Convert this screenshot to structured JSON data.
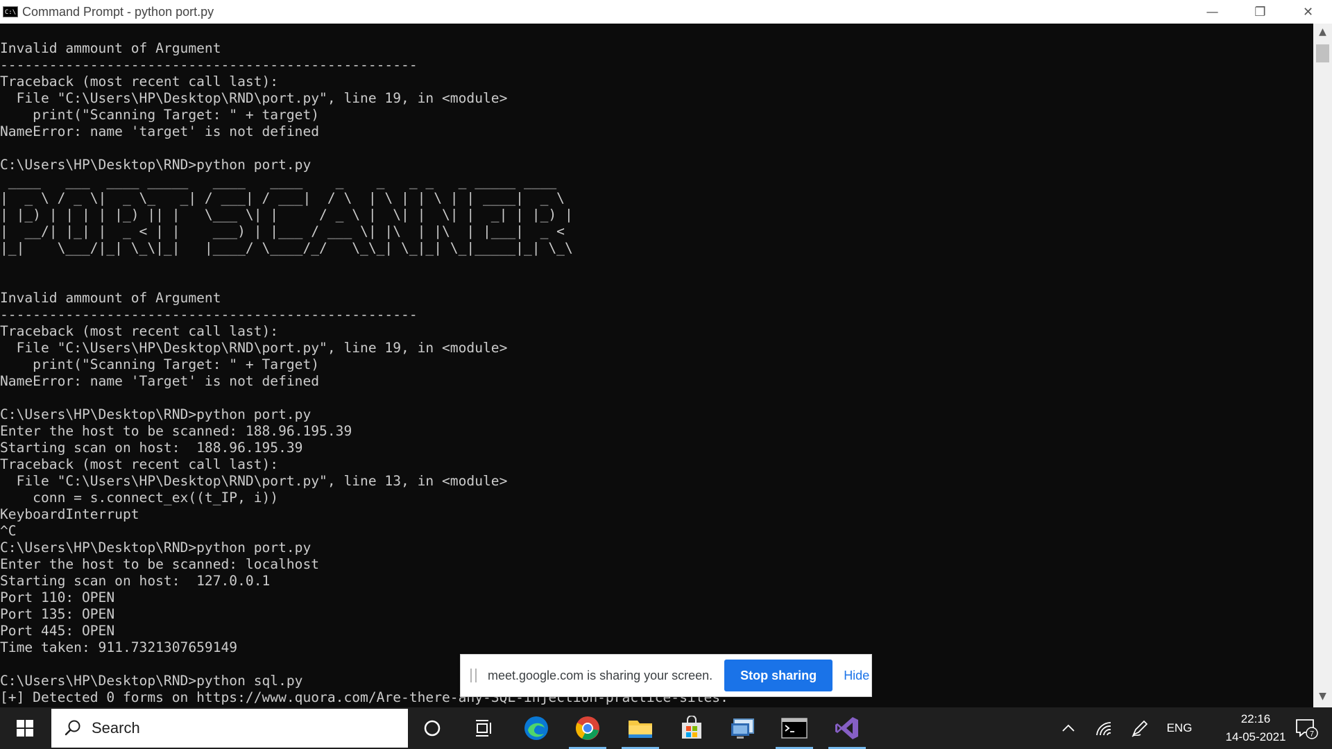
{
  "window": {
    "title": "Command Prompt - python  port.py",
    "icon_label": "C:\\",
    "controls": {
      "minimize": "—",
      "restore": "❐",
      "close": "✕"
    }
  },
  "console": {
    "lines": [
      "Invalid ammount of Argument",
      "---------------------------------------------------",
      "Traceback (most recent call last):",
      "  File \"C:\\Users\\HP\\Desktop\\RND\\port.py\", line 19, in <module>",
      "    print(\"Scanning Target: \" + target)",
      "NameError: name 'target' is not defined",
      "",
      "C:\\Users\\HP\\Desktop\\RND>python port.py",
      " ____   ___  ____ _____   ____   ____    _    _   _ _   _ _____ ____",
      "|  _ \\ / _ \\|  _ \\_   _| / ___| / ___|  / \\  | \\ | | \\ | | ____|  _ \\",
      "| |_) | | | | |_) || |   \\___ \\| |     / _ \\ |  \\| |  \\| |  _| | |_) |",
      "|  __/| |_| |  _ < | |    ___) | |___ / ___ \\| |\\  | |\\  | |___|  _ <",
      "|_|    \\___/|_| \\_\\|_|   |____/ \\____/_/   \\_\\_| \\_|_| \\_|_____|_| \\_\\",
      "",
      "",
      "Invalid ammount of Argument",
      "---------------------------------------------------",
      "Traceback (most recent call last):",
      "  File \"C:\\Users\\HP\\Desktop\\RND\\port.py\", line 19, in <module>",
      "    print(\"Scanning Target: \" + Target)",
      "NameError: name 'Target' is not defined",
      "",
      "C:\\Users\\HP\\Desktop\\RND>python port.py",
      "Enter the host to be scanned: 188.96.195.39",
      "Starting scan on host:  188.96.195.39",
      "Traceback (most recent call last):",
      "  File \"C:\\Users\\HP\\Desktop\\RND\\port.py\", line 13, in <module>",
      "    conn = s.connect_ex((t_IP, i))",
      "KeyboardInterrupt",
      "^C",
      "C:\\Users\\HP\\Desktop\\RND>python port.py",
      "Enter the host to be scanned: localhost",
      "Starting scan on host:  127.0.0.1",
      "Port 110: OPEN",
      "Port 135: OPEN",
      "Port 445: OPEN",
      "Time taken: 911.7321307659149",
      "",
      "C:\\Users\\HP\\Desktop\\RND>python sql.py",
      "[+] Detected 0 forms on https://www.quora.com/Are-there-any-SQL-injection-practice-sites."
    ]
  },
  "scrollbar": {
    "up": "▲",
    "down": "▼"
  },
  "sharing_bar": {
    "message": "meet.google.com is sharing your screen.",
    "stop_label": "Stop sharing",
    "hide_label": "Hide"
  },
  "taskbar": {
    "search_placeholder": "Search",
    "apps": [
      "cortana",
      "task-view",
      "edge",
      "chrome",
      "file-explorer",
      "store",
      "remote-desktop",
      "command-prompt",
      "visual-studio"
    ],
    "tray": {
      "language": "ENG",
      "time": "22:16",
      "date": "14-05-2021",
      "notification_count": "7"
    }
  },
  "colors": {
    "console_bg": "#0c0c0c",
    "console_fg": "#cccccc",
    "taskbar_bg": "#1f1f1f",
    "accent": "#1a73e8"
  }
}
